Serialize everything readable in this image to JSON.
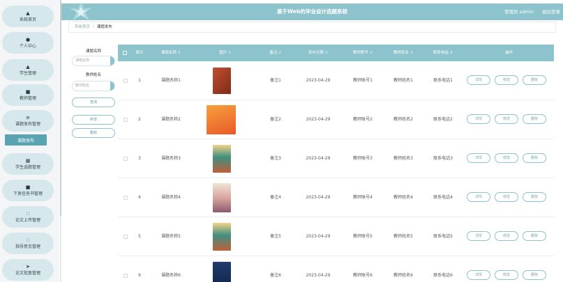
{
  "header": {
    "title": "基于Web的毕业设计选题系统",
    "user": "管理员 admin",
    "logout": "退出登录"
  },
  "sidebar": {
    "items": [
      {
        "label": "系统首页",
        "icon": "home-icon"
      },
      {
        "label": "个人中心",
        "icon": "user-icon"
      },
      {
        "label": "学生管理",
        "icon": "student-icon"
      },
      {
        "label": "教师管理",
        "icon": "teacher-icon"
      },
      {
        "label": "课题发布管理",
        "icon": "settings-icon"
      },
      {
        "label": "学生选题管理",
        "icon": "grid-icon"
      },
      {
        "label": "下发任务书管理",
        "icon": "doc-icon"
      },
      {
        "label": "论文上传管理",
        "icon": "apps-icon"
      },
      {
        "label": "指导意见管理",
        "icon": "apps-icon"
      },
      {
        "label": "论文批复管理",
        "icon": "send-icon"
      }
    ],
    "active_sub": "课题发布"
  },
  "breadcrumb": {
    "home": "系统首页",
    "current": "课题发布"
  },
  "filters": {
    "topic_label": "课题名称",
    "topic_placeholder": "课题名称",
    "teacher_label": "教师姓名",
    "teacher_placeholder": "教师姓名",
    "query_button": "查询",
    "add_button": "新增",
    "delete_button": "删除"
  },
  "table": {
    "columns": [
      "索引",
      "课题名称",
      "图片",
      "备注",
      "发布日期",
      "教师账号",
      "教师姓名",
      "联系电话",
      "操作"
    ],
    "actions": {
      "detail": "详情",
      "edit": "修改",
      "delete": "删除"
    },
    "rows": [
      {
        "index": "1",
        "name": "课题名称1",
        "remark": "备注1",
        "date": "2023-04-29",
        "account": "教师账号1",
        "teacher": "教师姓名1",
        "phone": "联系电话1"
      },
      {
        "index": "2",
        "name": "课题名称2",
        "remark": "备注2",
        "date": "2023-04-29",
        "account": "教师账号2",
        "teacher": "教师姓名2",
        "phone": "联系电话2"
      },
      {
        "index": "3",
        "name": "课题名称3",
        "remark": "备注3",
        "date": "2023-04-29",
        "account": "教师账号3",
        "teacher": "教师姓名3",
        "phone": "联系电话3"
      },
      {
        "index": "4",
        "name": "课题名称4",
        "remark": "备注4",
        "date": "2023-04-29",
        "account": "教师账号4",
        "teacher": "教师姓名4",
        "phone": "联系电话4"
      },
      {
        "index": "5",
        "name": "课题名称5",
        "remark": "备注5",
        "date": "2023-04-29",
        "account": "教师账号5",
        "teacher": "教师姓名5",
        "phone": "联系电话5"
      },
      {
        "index": "6",
        "name": "课题名称6",
        "remark": "备注6",
        "date": "2023-04-29",
        "account": "教师账号6",
        "teacher": "教师姓名6",
        "phone": "联系电话6"
      }
    ]
  },
  "colors": {
    "accent": "#8cc3cd",
    "sidebar_item": "#d6e8ec",
    "active": "#5aa3b2"
  }
}
